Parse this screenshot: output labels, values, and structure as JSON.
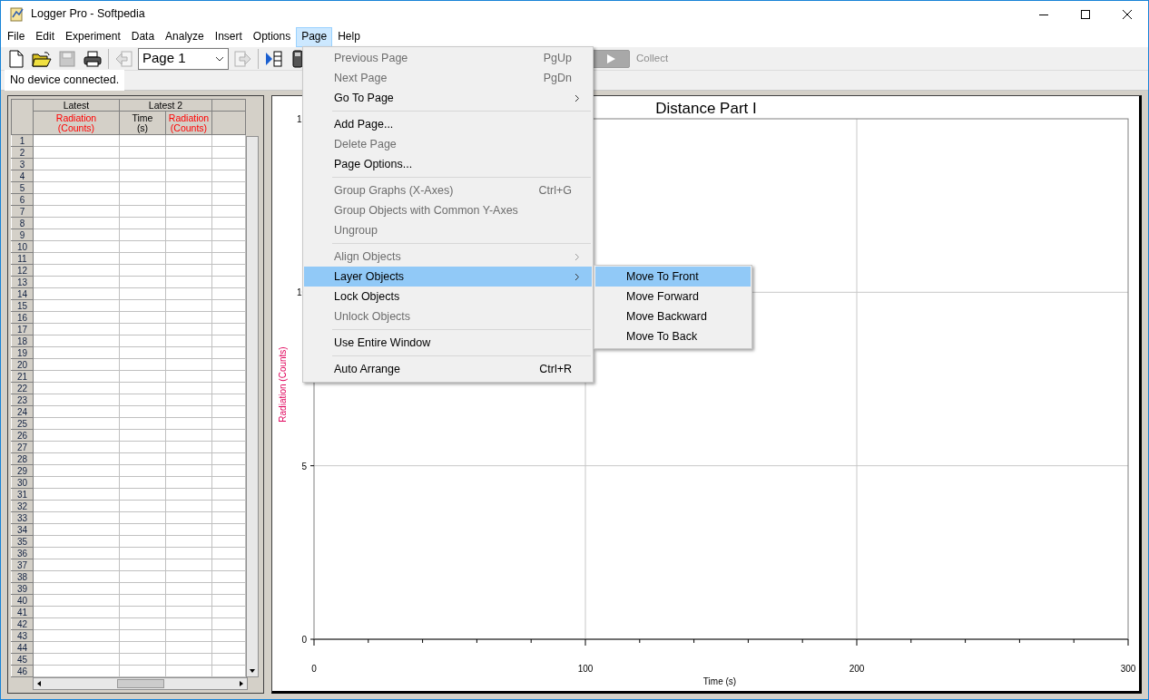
{
  "window": {
    "title": "Logger Pro - Softpedia"
  },
  "menu_bar": [
    {
      "label": "File",
      "selected": false
    },
    {
      "label": "Edit",
      "selected": false
    },
    {
      "label": "Experiment",
      "selected": false
    },
    {
      "label": "Data",
      "selected": false
    },
    {
      "label": "Analyze",
      "selected": false
    },
    {
      "label": "Insert",
      "selected": false
    },
    {
      "label": "Options",
      "selected": false
    },
    {
      "label": "Page",
      "selected": true
    },
    {
      "label": "Help",
      "selected": false
    }
  ],
  "toolbar": {
    "page_select": {
      "value": "Page 1"
    },
    "collect_button": {
      "label": "Collect",
      "disabled": true
    }
  },
  "status": "No device connected.",
  "table": {
    "data_sets": [
      {
        "name": "Latest",
        "columns": [
          {
            "label": "Radiation",
            "unit": "(Counts)",
            "color": "#ff0000"
          }
        ]
      },
      {
        "name": "Latest 2",
        "columns": [
          {
            "label": "Time",
            "unit": "(s)",
            "color": "#000000"
          },
          {
            "label": "Radiation",
            "unit": "(Counts)",
            "color": "#ff0000"
          }
        ]
      }
    ],
    "row_numbers": [
      "1",
      "2",
      "3",
      "4",
      "5",
      "6",
      "7",
      "8",
      "9",
      "10",
      "11",
      "12",
      "13",
      "14",
      "15",
      "16",
      "17",
      "18",
      "19",
      "20",
      "21",
      "22",
      "23",
      "24",
      "25",
      "26",
      "27",
      "28",
      "29",
      "30",
      "31",
      "32",
      "33",
      "34",
      "35",
      "36",
      "37",
      "38",
      "39",
      "40",
      "41",
      "42",
      "43",
      "44",
      "45",
      "46"
    ]
  },
  "graph": {
    "chart_data": {
      "type": "line",
      "title": "Distance Part I",
      "xlabel": "Time (s)",
      "ylabel": "Radiation (Counts)",
      "xlim": [
        0,
        300
      ],
      "ylim": [
        0,
        15
      ],
      "xticks": [
        0,
        100,
        200,
        300
      ],
      "yticks": [
        0,
        5,
        10,
        15
      ],
      "grid": true
    }
  },
  "page_menu": [
    {
      "kind": "item",
      "label": "Previous Page",
      "shortcut": "PgUp",
      "disabled": true,
      "submenu": false,
      "selected": false
    },
    {
      "kind": "item",
      "label": "Next Page",
      "shortcut": "PgDn",
      "disabled": true,
      "submenu": false,
      "selected": false
    },
    {
      "kind": "item",
      "label": "Go To Page",
      "disabled": false,
      "submenu": true,
      "selected": false
    },
    {
      "kind": "separator"
    },
    {
      "kind": "item",
      "label": "Add Page...",
      "disabled": false,
      "submenu": false,
      "selected": false
    },
    {
      "kind": "item",
      "label": "Delete Page",
      "disabled": true,
      "submenu": false,
      "selected": false
    },
    {
      "kind": "item",
      "label": "Page Options...",
      "disabled": false,
      "submenu": false,
      "selected": false
    },
    {
      "kind": "separator"
    },
    {
      "kind": "item",
      "label": "Group Graphs (X-Axes)",
      "shortcut": "Ctrl+G",
      "disabled": true,
      "submenu": false,
      "selected": false
    },
    {
      "kind": "item",
      "label": "Group Objects with Common Y-Axes",
      "disabled": true,
      "submenu": false,
      "selected": false
    },
    {
      "kind": "item",
      "label": "Ungroup",
      "disabled": true,
      "submenu": false,
      "selected": false
    },
    {
      "kind": "separator"
    },
    {
      "kind": "item",
      "label": "Align Objects",
      "disabled": true,
      "submenu": true,
      "selected": false
    },
    {
      "kind": "item",
      "label": "Layer Objects",
      "disabled": false,
      "submenu": true,
      "selected": true
    },
    {
      "kind": "item",
      "label": "Lock Objects",
      "disabled": false,
      "submenu": false,
      "selected": false
    },
    {
      "kind": "item",
      "label": "Unlock Objects",
      "disabled": true,
      "submenu": false,
      "selected": false
    },
    {
      "kind": "separator"
    },
    {
      "kind": "item",
      "label": "Use Entire Window",
      "disabled": false,
      "submenu": false,
      "selected": false
    },
    {
      "kind": "separator"
    },
    {
      "kind": "item",
      "label": "Auto Arrange",
      "shortcut": "Ctrl+R",
      "disabled": false,
      "submenu": false,
      "selected": false
    }
  ],
  "layer_submenu": [
    {
      "label": "Move To Front",
      "selected": true
    },
    {
      "label": "Move Forward",
      "selected": false
    },
    {
      "label": "Move Backward",
      "selected": false
    },
    {
      "label": "Move To Back",
      "selected": false
    }
  ]
}
